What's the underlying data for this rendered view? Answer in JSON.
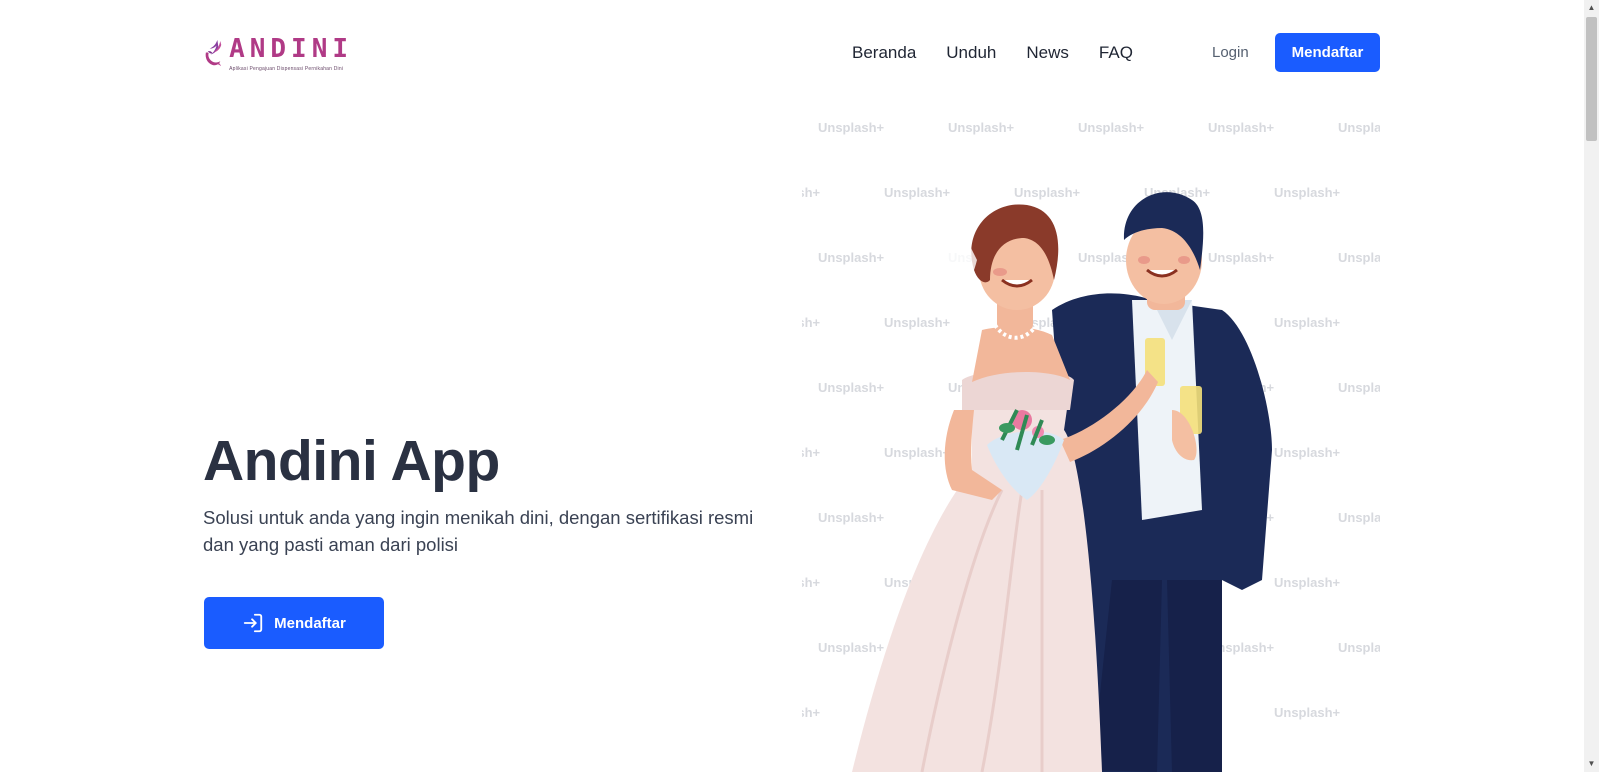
{
  "brand": {
    "name": "ANDINI",
    "tagline": "Aplikasi Pengajuan Dispensasi Pernikahan Dini",
    "primary_color": "#1a5cff",
    "logo_color": "#b03a86"
  },
  "nav": {
    "items": [
      {
        "label": "Beranda"
      },
      {
        "label": "Unduh"
      },
      {
        "label": "News"
      },
      {
        "label": "FAQ"
      }
    ],
    "login_label": "Login",
    "signup_label": "Mendaftar"
  },
  "hero": {
    "title": "Andini App",
    "description": "Solusi untuk anda yang ingin menikah dini, dengan sertifikasi resmi dan yang pasti aman dari polisi",
    "cta_label": "Mendaftar",
    "cta_icon": "login-icon"
  },
  "illustration": {
    "subject": "wedding-couple-illustration",
    "watermark_text": "Unsplash+"
  }
}
